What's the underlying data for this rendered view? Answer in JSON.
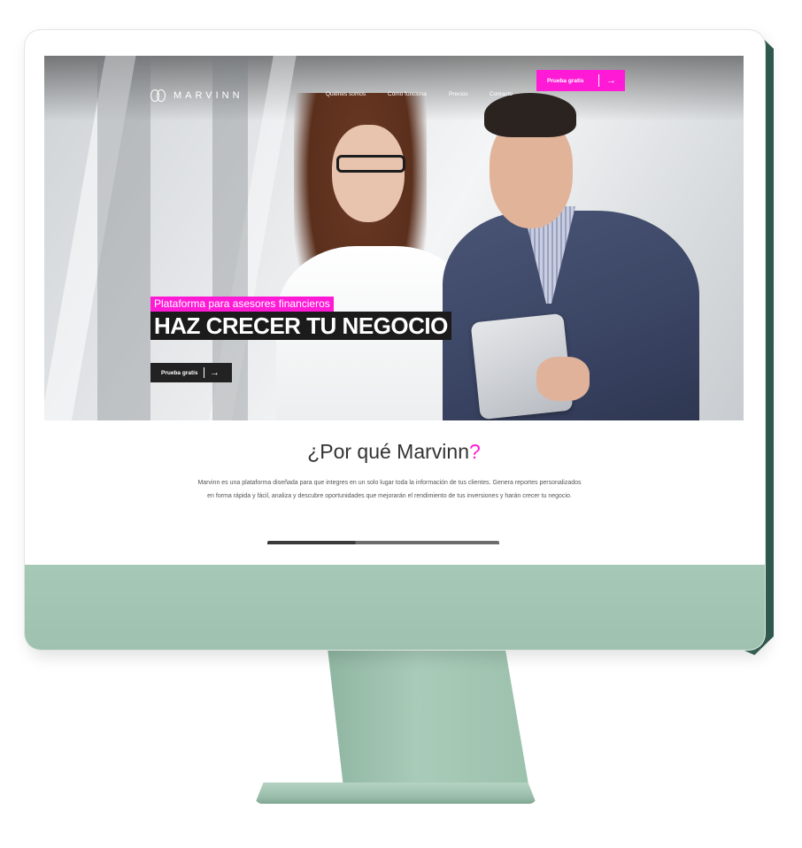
{
  "brand": {
    "name": "MARVINN",
    "accent_color": "#ff1bd6",
    "dark_color": "#1b1b1b"
  },
  "nav": {
    "links": [
      "Quiénes somos",
      "Cómo funciona",
      "Precios",
      "Contacto"
    ],
    "cta_label": "Prueba gratis",
    "cta_icon": "arrow-right-icon"
  },
  "hero": {
    "tagline": "Plataforma para asesores financieros",
    "headline": "HAZ CRECER TU NEGOCIO",
    "cta_label": "Prueba gratis",
    "cta_icon": "arrow-right-icon"
  },
  "why": {
    "title_prefix": "¿Por qué Marvinn",
    "title_suffix": "?",
    "body": "Marvinn es una plataforma diseñada para que integres en un solo lugar toda la información de tus clientes. Genera reportes personalizados en forma rápida y fácil, analiza y descubre oportunidades que mejorarán el rendimiento de tus inversiones y harán crecer tu negocio."
  },
  "device": {
    "body_color": "#a6c8b6",
    "back_color": "#2f5a4f"
  }
}
